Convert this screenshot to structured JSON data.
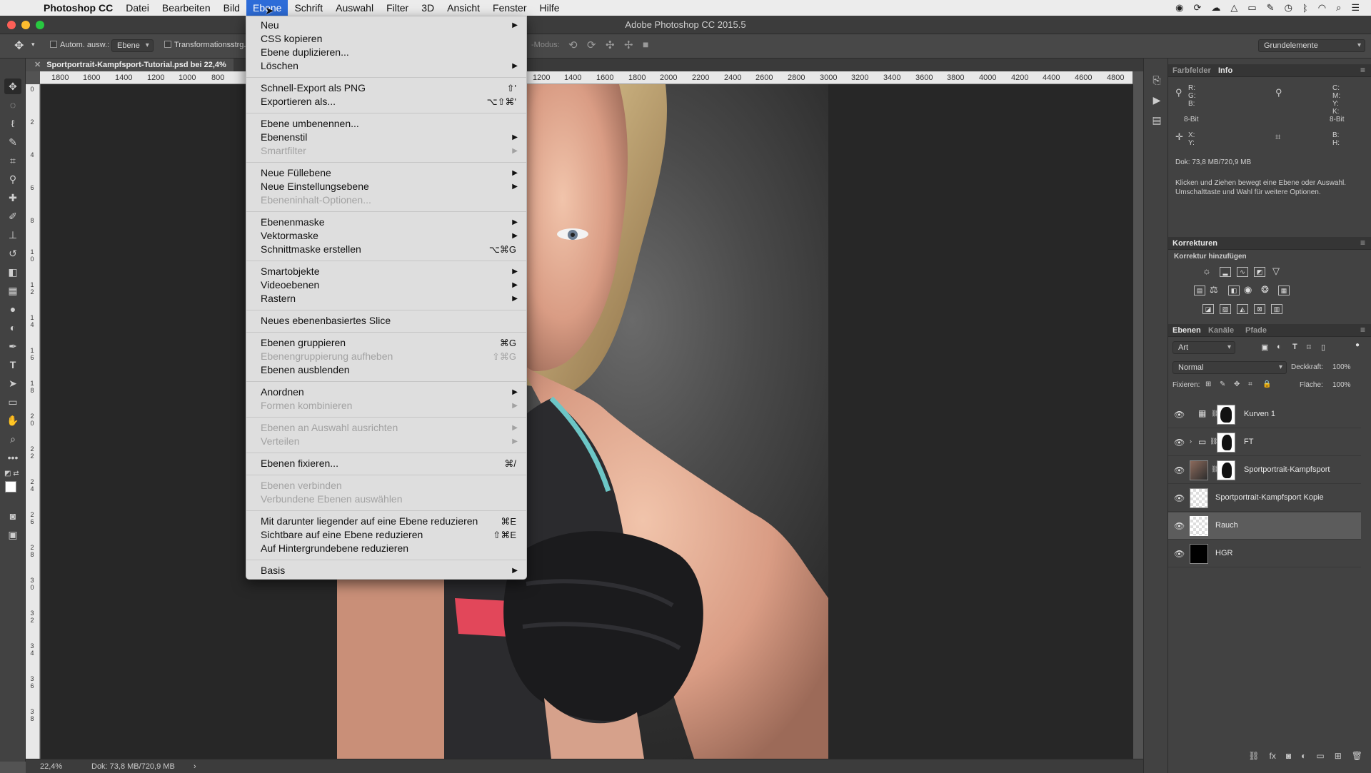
{
  "menubar": {
    "app_name": "Photoshop CC",
    "items": [
      "Datei",
      "Bearbeiten",
      "Bild",
      "Ebene",
      "Schrift",
      "Auswahl",
      "Filter",
      "3D",
      "Ansicht",
      "Fenster",
      "Hilfe"
    ],
    "active_item": "Ebene"
  },
  "window": {
    "title": "Adobe Photoshop CC 2015.5"
  },
  "options_bar": {
    "auto_select_label": "Autom. ausw.:",
    "auto_select_value": "Ebene",
    "transform_label": "Transformationsstrg.",
    "mode_label": "-Modus:",
    "workspace": "Grundelemente"
  },
  "document": {
    "tab_title": "Sportportrait-Kampfsport-Tutorial.psd bei 22,4%",
    "ruler_left": [
      "1800",
      "1600",
      "1400",
      "1200",
      "1000",
      "800"
    ],
    "ruler_right": [
      "1200",
      "1400",
      "1600",
      "1800",
      "2000",
      "2200",
      "2400",
      "2600",
      "2800",
      "3000",
      "3200",
      "3400",
      "3600",
      "3800",
      "4000",
      "4200",
      "4400",
      "4600",
      "4800"
    ],
    "vruler": [
      "0",
      "2",
      "4",
      "6",
      "8",
      "1 0",
      "1 2",
      "1 4",
      "1 6",
      "1 8",
      "2 0",
      "2 2",
      "2 4",
      "2 6",
      "2 8",
      "3 0",
      "3 2",
      "3 4",
      "3 6",
      "3 8"
    ]
  },
  "statusbar": {
    "zoom": "22,4%",
    "doc_size": "Dok: 73,8 MB/720,9 MB",
    "arrow": "›"
  },
  "ebene_menu": {
    "groups": [
      [
        {
          "label": "Neu",
          "submenu": true
        },
        {
          "label": "CSS kopieren"
        },
        {
          "label": "Ebene duplizieren..."
        },
        {
          "label": "Löschen",
          "submenu": true
        }
      ],
      [
        {
          "label": "Schnell-Export als PNG",
          "shortcut": "⇧'"
        },
        {
          "label": "Exportieren als...",
          "shortcut": "⌥⇧⌘'"
        }
      ],
      [
        {
          "label": "Ebene umbenennen..."
        },
        {
          "label": "Ebenenstil",
          "submenu": true
        },
        {
          "label": "Smartfilter",
          "submenu": true,
          "disabled": true
        }
      ],
      [
        {
          "label": "Neue Füllebene",
          "submenu": true
        },
        {
          "label": "Neue Einstellungsebene",
          "submenu": true
        },
        {
          "label": "Ebeneninhalt-Optionen...",
          "disabled": true
        }
      ],
      [
        {
          "label": "Ebenenmaske",
          "submenu": true
        },
        {
          "label": "Vektormaske",
          "submenu": true
        },
        {
          "label": "Schnittmaske erstellen",
          "shortcut": "⌥⌘G"
        }
      ],
      [
        {
          "label": "Smartobjekte",
          "submenu": true
        },
        {
          "label": "Videoebenen",
          "submenu": true
        },
        {
          "label": "Rastern",
          "submenu": true
        }
      ],
      [
        {
          "label": "Neues ebenenbasiertes Slice"
        }
      ],
      [
        {
          "label": "Ebenen gruppieren",
          "shortcut": "⌘G"
        },
        {
          "label": "Ebenengruppierung aufheben",
          "shortcut": "⇧⌘G",
          "disabled": true
        },
        {
          "label": "Ebenen ausblenden"
        }
      ],
      [
        {
          "label": "Anordnen",
          "submenu": true
        },
        {
          "label": "Formen kombinieren",
          "submenu": true,
          "disabled": true
        }
      ],
      [
        {
          "label": "Ebenen an Auswahl ausrichten",
          "submenu": true,
          "disabled": true
        },
        {
          "label": "Verteilen",
          "submenu": true,
          "disabled": true
        }
      ],
      [
        {
          "label": "Ebenen fixieren...",
          "shortcut": "⌘/"
        }
      ],
      [
        {
          "label": "Ebenen verbinden",
          "disabled": true
        },
        {
          "label": "Verbundene Ebenen auswählen",
          "disabled": true
        }
      ],
      [
        {
          "label": "Mit darunter liegender auf eine Ebene reduzieren",
          "shortcut": "⌘E"
        },
        {
          "label": "Sichtbare auf eine Ebene reduzieren",
          "shortcut": "⇧⌘E"
        },
        {
          "label": "Auf Hintergrundebene reduzieren"
        }
      ],
      [
        {
          "label": "Basis",
          "submenu": true
        }
      ]
    ]
  },
  "info_panel": {
    "tabs": [
      "Farbfelder",
      "Info"
    ],
    "active_tab": "Info",
    "rgb_labels": "R:\nG:\nB:",
    "cmyk_labels": "C:\nM:\nY:\nK:",
    "bit_left": "8-Bit",
    "bit_right": "8-Bit",
    "xy_labels": "X:\nY:",
    "bh_labels": "B:\nH:",
    "doc": "Dok: 73,8 MB/720,9 MB",
    "hint": "Klicken und Ziehen bewegt eine Ebene oder Auswahl. Umschalttaste und Wahl für weitere Optionen."
  },
  "corrections_panel": {
    "title": "Korrekturen",
    "subtitle": "Korrektur hinzufügen"
  },
  "layers_panel": {
    "tabs": [
      "Ebenen",
      "Kanäle",
      "Pfade"
    ],
    "active_tab": "Ebenen",
    "filter": "Art",
    "blend_mode": "Normal",
    "opacity_label": "Deckkraft:",
    "opacity": "100%",
    "lock_label": "Fixieren:",
    "fill_label": "Fläche:",
    "fill": "100%",
    "layers": [
      {
        "name": "Kurven 1"
      },
      {
        "name": "FT"
      },
      {
        "name": "Sportportrait-Kampfsport"
      },
      {
        "name": "Sportportrait-Kampfsport Kopie"
      },
      {
        "name": "Rauch"
      },
      {
        "name": "HGR"
      }
    ],
    "active_layer": "Rauch"
  },
  "colors": {
    "accent": "#2d6cd8",
    "menu_bg": "#dedede",
    "panel_bg": "#424242",
    "canvas_bg": "#272727"
  }
}
